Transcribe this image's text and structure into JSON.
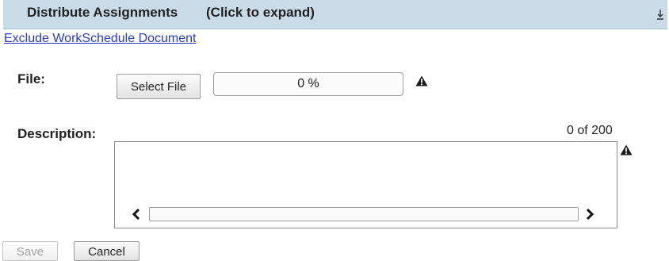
{
  "header": {
    "title": "Distribute Assignments",
    "hint": "(Click to expand)",
    "expand_icon": "expand-down-icon"
  },
  "links": {
    "exclude": "Exclude WorkSchedule Document"
  },
  "file": {
    "label": "File:",
    "select_button": "Select File",
    "progress_text": "0 %",
    "progress_value": 0,
    "warning_icon": "warning-triangle-icon"
  },
  "description": {
    "label": "Description:",
    "counter": "0 of 200",
    "value": "",
    "warning_icon": "warning-triangle-icon"
  },
  "actions": {
    "save": "Save",
    "cancel": "Cancel"
  },
  "colors": {
    "header_bg": "#c8dbe7",
    "link": "#2a39c9",
    "disabled_text": "#a3a3a3"
  }
}
